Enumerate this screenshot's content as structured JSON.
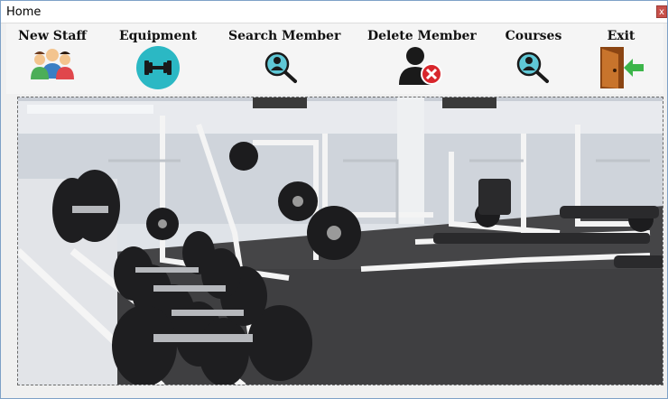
{
  "window": {
    "title": "Home",
    "close_label": "x"
  },
  "toolbar": {
    "new_staff": "New Staff",
    "equipment": "Equipment",
    "search_member": "Search Member",
    "delete_member": "Delete Member",
    "courses": "Courses",
    "exit": "Exit"
  },
  "colors": {
    "equipment_icon_bg": "#2bb8c4",
    "search_icon_bg": "#5fc8d6",
    "delete_badge": "#d8262c",
    "exit_arrow": "#3cb54a",
    "door": "#c8742c"
  },
  "icons": [
    "staff-group-icon",
    "dumbbell-icon",
    "user-search-icon",
    "user-delete-icon",
    "user-search-icon",
    "exit-door-icon"
  ]
}
